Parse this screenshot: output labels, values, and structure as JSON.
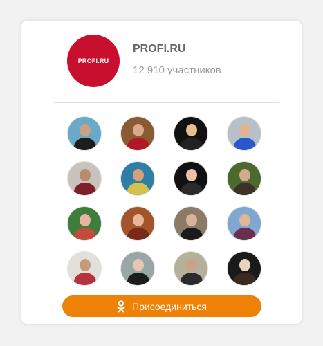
{
  "group": {
    "logo_text": "PROFI.RU",
    "name": "PROFI.RU",
    "members": "12 910 участников"
  },
  "join_button": {
    "label": "Присоединиться",
    "icon": "odnoklassniki-icon"
  },
  "colors": {
    "logo_bg": "#c8102e",
    "button_bg": "#ee8208",
    "name_text": "#666666",
    "members_text": "#9a9a9a"
  },
  "members_grid": [
    {
      "bg": "#6aa9c8",
      "skin": "#caa184",
      "cloth": "#1d1d1d"
    },
    {
      "bg": "#8a5a32",
      "skin": "#d9a98a",
      "cloth": "#b01826"
    },
    {
      "bg": "#111111",
      "skin": "#e8c08e",
      "cloth": "#222222"
    },
    {
      "bg": "#b7c0c8",
      "skin": "#e0b48e",
      "cloth": "#2a58c8"
    },
    {
      "bg": "#c9c3bd",
      "skin": "#b88a6e",
      "cloth": "#7c1f2a"
    },
    {
      "bg": "#2f7ea6",
      "skin": "#d6a07d",
      "cloth": "#d6c24a"
    },
    {
      "bg": "#101010",
      "skin": "#e9c1a6",
      "cloth": "#2a2a2a"
    },
    {
      "bg": "#4d6a2e",
      "skin": "#d3a88c",
      "cloth": "#3c3226"
    },
    {
      "bg": "#3e7d3c",
      "skin": "#e5b5a2",
      "cloth": "#c44a3a"
    },
    {
      "bg": "#a3542a",
      "skin": "#e8b69a",
      "cloth": "#7a2a1a"
    },
    {
      "bg": "#8a7a66",
      "skin": "#d8b29a",
      "cloth": "#1a1a1a"
    },
    {
      "bg": "#7fa7cf",
      "skin": "#e0b796",
      "cloth": "#6a2f4a"
    },
    {
      "bg": "#e3e0dc",
      "skin": "#c79a7c",
      "cloth": "#b5333a"
    },
    {
      "bg": "#98a6a6",
      "skin": "#e6c6b0",
      "cloth": "#1c1c1c"
    },
    {
      "bg": "#b6b09a",
      "skin": "#c8a38c",
      "cloth": "#2b2b2b"
    },
    {
      "bg": "#1a1a1a",
      "skin": "#e8d2c0",
      "cloth": "#3a2a20"
    }
  ]
}
